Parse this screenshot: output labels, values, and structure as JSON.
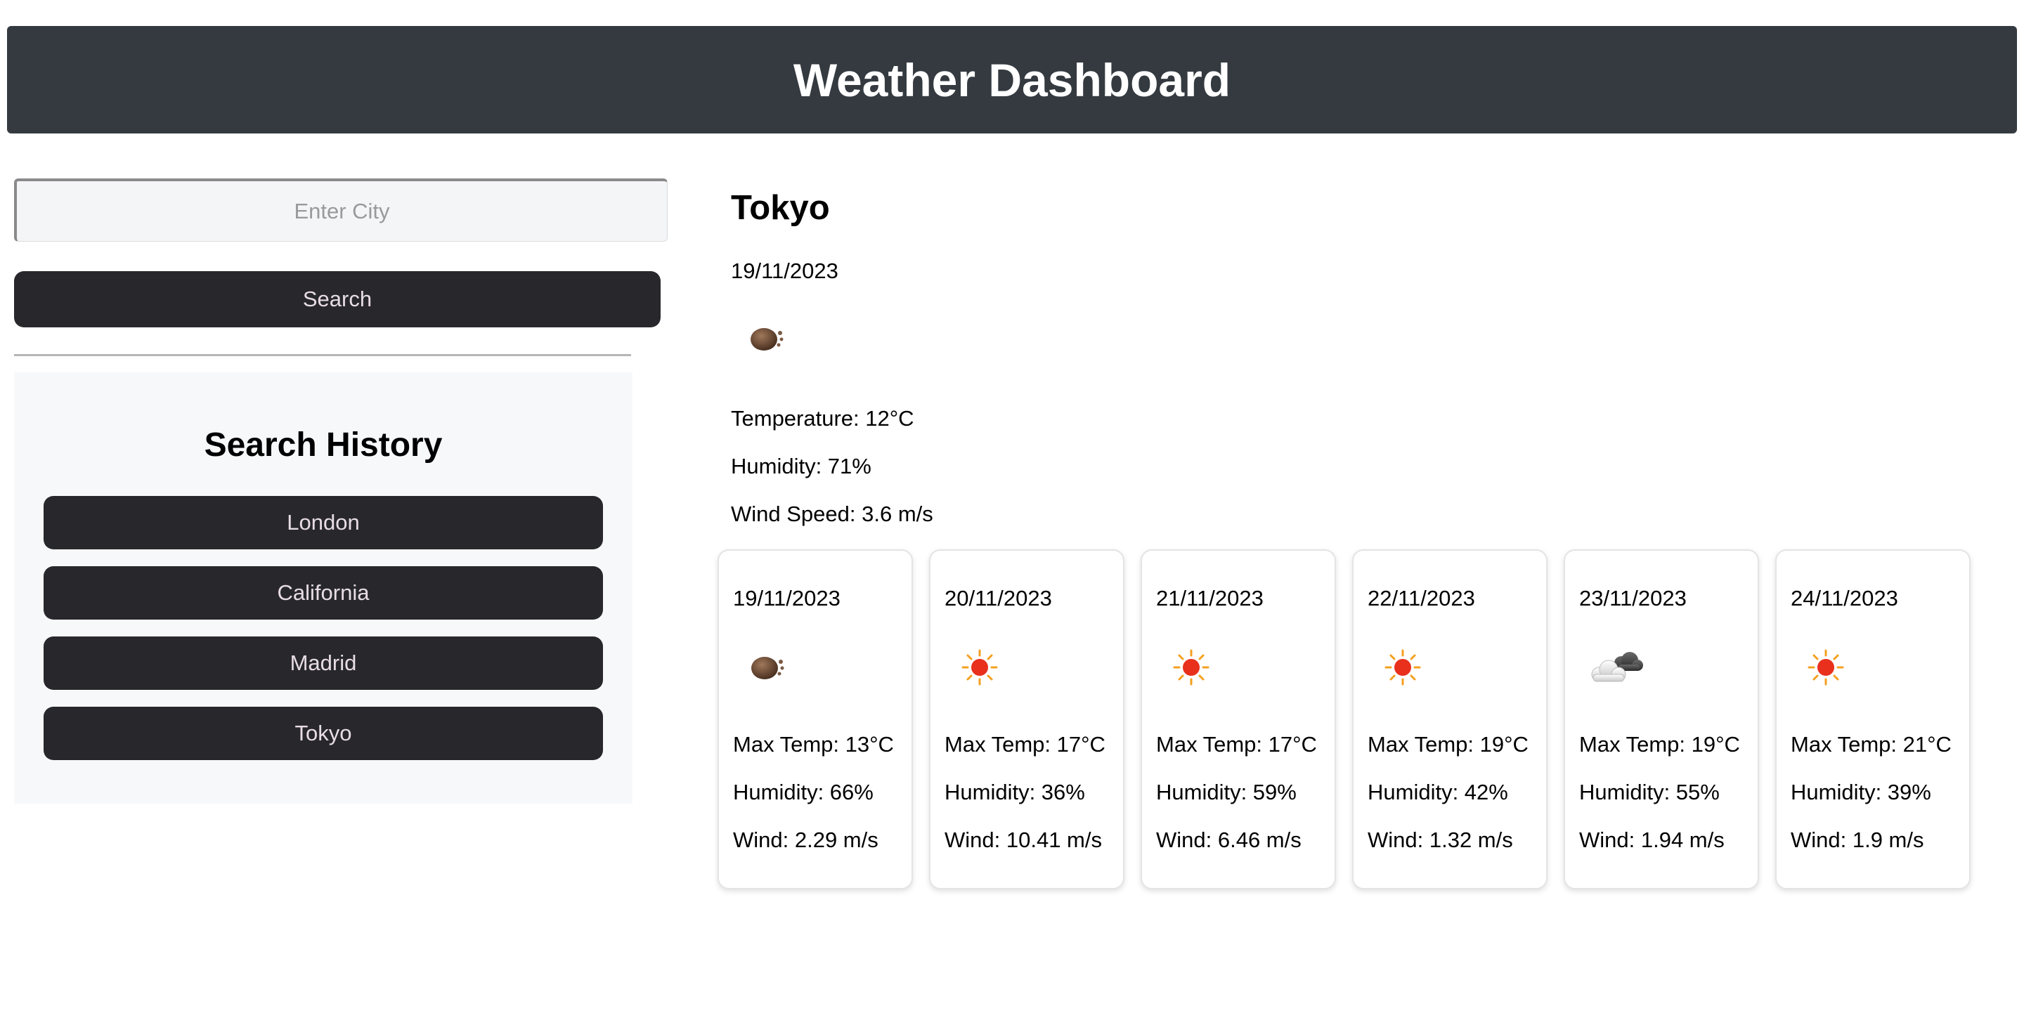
{
  "header": {
    "title": "Weather Dashboard"
  },
  "search": {
    "placeholder": "Enter City",
    "value": "",
    "button_label": "Search"
  },
  "history": {
    "title": "Search History",
    "items": [
      "London",
      "California",
      "Madrid",
      "Tokyo"
    ]
  },
  "current": {
    "city": "Tokyo",
    "date": "19/11/2023",
    "icon": "haze-icon",
    "temperature": "Temperature: 12°C",
    "humidity": "Humidity: 71%",
    "wind": "Wind Speed: 3.6 m/s"
  },
  "forecast": [
    {
      "date": "19/11/2023",
      "icon": "haze-icon",
      "max_temp": "Max Temp: 13°C",
      "humidity": "Humidity: 66%",
      "wind": "Wind: 2.29 m/s"
    },
    {
      "date": "20/11/2023",
      "icon": "sun-icon",
      "max_temp": "Max Temp: 17°C",
      "humidity": "Humidity: 36%",
      "wind": "Wind: 10.41 m/s"
    },
    {
      "date": "21/11/2023",
      "icon": "sun-icon",
      "max_temp": "Max Temp: 17°C",
      "humidity": "Humidity: 59%",
      "wind": "Wind: 6.46 m/s"
    },
    {
      "date": "22/11/2023",
      "icon": "sun-icon",
      "max_temp": "Max Temp: 19°C",
      "humidity": "Humidity: 42%",
      "wind": "Wind: 1.32 m/s"
    },
    {
      "date": "23/11/2023",
      "icon": "clouds-icon",
      "max_temp": "Max Temp: 19°C",
      "humidity": "Humidity: 55%",
      "wind": "Wind: 1.94 m/s"
    },
    {
      "date": "24/11/2023",
      "icon": "sun-icon",
      "max_temp": "Max Temp: 21°C",
      "humidity": "Humidity: 39%",
      "wind": "Wind: 1.9 m/s"
    }
  ]
}
